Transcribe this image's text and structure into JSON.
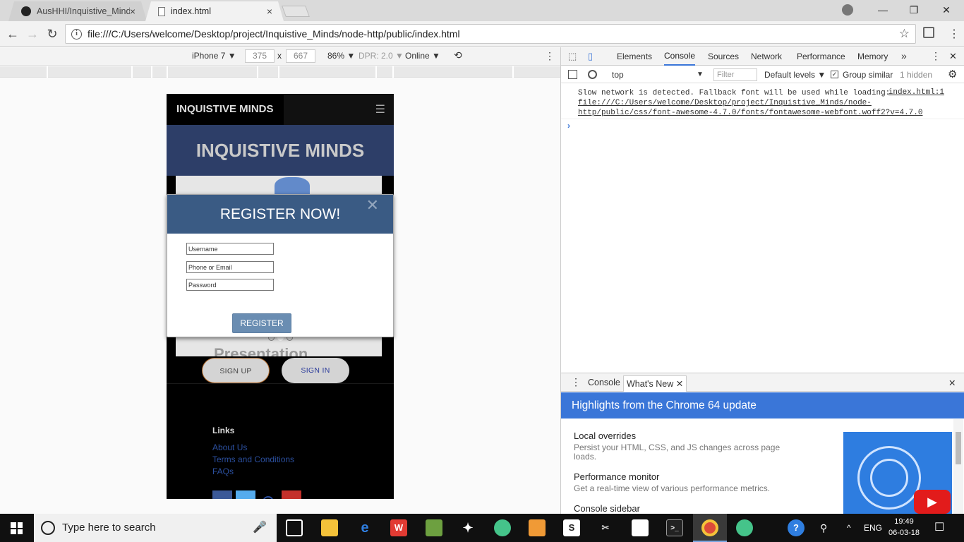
{
  "browser": {
    "tabs": [
      {
        "title": "AusHHI/Inquistive_Minds",
        "close": "×",
        "active": false
      },
      {
        "title": "index.html",
        "close": "×",
        "active": true
      }
    ],
    "window_controls": {
      "minimize": "—",
      "restore": "❐",
      "close": "✕"
    },
    "nav": {
      "back": "←",
      "forward": "→",
      "reload": "↻"
    },
    "url": "file:///C:/Users/welcome/Desktop/project/Inquistive_Minds/node-http/public/index.html",
    "bookmark_star": "☆",
    "menu_dots": "⋮"
  },
  "device_toolbar": {
    "device": "iPhone 7 ▼",
    "width": "375",
    "times": "x",
    "height": "667",
    "zoom": "86% ▼",
    "dpr": "DPR: 2.0 ▼",
    "network": "Online ▼",
    "rotate": "⟲",
    "more": "⋮"
  },
  "site": {
    "brand": "INQUISTIVE MINDS",
    "hamburger": "☰",
    "hero_title": "INQUISTIVE MINDS",
    "carousel_caption": "Presentation",
    "signup": "SIGN UP",
    "signin": "SIGN IN",
    "links_title": "Links",
    "links": [
      "About Us",
      "Terms and Conditions",
      "FAQs"
    ]
  },
  "modal": {
    "title": "REGISTER NOW!",
    "close": "✕",
    "fields": [
      {
        "placeholder": "Username"
      },
      {
        "placeholder": "Phone or Email"
      },
      {
        "placeholder": "Password"
      }
    ],
    "submit": "REGISTER"
  },
  "devtools": {
    "tabs": [
      "Elements",
      "Console",
      "Sources",
      "Network",
      "Performance",
      "Memory"
    ],
    "selected_tab": "Console",
    "more_tabs": "»",
    "context": "top",
    "filter_placeholder": "Filter",
    "levels": "Default levels ▼",
    "group_similar": "Group similar",
    "hidden": "1 hidden",
    "message_text": "Slow network is detected. Fallback font will be used while loading: ",
    "message_link": "file:///C:/Users/welcome/Desktop/project/Inquistive_Minds/node-http/public/css/font-awesome-4.7.0/fonts/fontawesome-webfont.woff2?v=4.7.0",
    "message_source": "index.html:1",
    "prompt": "›",
    "drawer_tabs": [
      "Console",
      "What's New"
    ],
    "drawer_close": "✕",
    "highlights_title": "Highlights from the Chrome 64 update",
    "whats_new": [
      {
        "title": "Local overrides",
        "desc": "Persist your HTML, CSS, and JS changes across page loads."
      },
      {
        "title": "Performance monitor",
        "desc": "Get a real-time view of various performance metrics."
      },
      {
        "title": "Console sidebar",
        "desc": ""
      }
    ],
    "play": "▶"
  },
  "taskbar": {
    "search_placeholder": "Type here to search",
    "mic": "🎤",
    "language": "ENG",
    "time": "19:49",
    "date": "06-03-18",
    "help": "?",
    "people": "⚲",
    "chevron": "^",
    "notifications": "☐"
  }
}
